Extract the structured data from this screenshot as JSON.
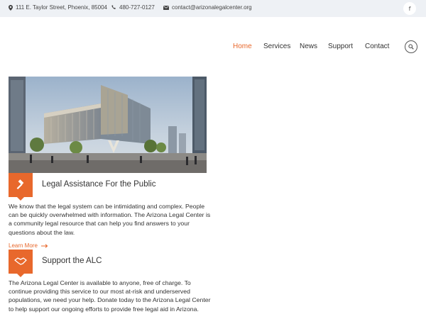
{
  "topbar": {
    "address": "111 E. Taylor Street, Phoenix, 85004",
    "phone": "480-727-0127",
    "email": "contact@arizonalegalcenter.org",
    "facebook": "f"
  },
  "nav": {
    "items": [
      "Home",
      "Services",
      "News",
      "Support",
      "Contact"
    ],
    "active": "Home"
  },
  "sections": [
    {
      "title": "Legal Assistance For the Public",
      "body": "We know that the legal system can be intimidating and complex. People can be quickly overwhelmed with information. The Arizona Legal Center is a community legal resource that can help you find answers to your questions about the law.",
      "link": "Learn More",
      "icon": "gavel-icon"
    },
    {
      "title": "Support the ALC",
      "body": "The Arizona Legal Center is available to anyone, free of charge. To continue providing this service to our most at-risk and underserved populations, we need your help. Donate today to the Arizona Legal Center to help support our ongoing efforts to provide free legal aid in Arizona.",
      "icon": "handshake-icon"
    }
  ],
  "colors": {
    "accent": "#e8682c",
    "topbar_bg": "#eef1f5"
  }
}
